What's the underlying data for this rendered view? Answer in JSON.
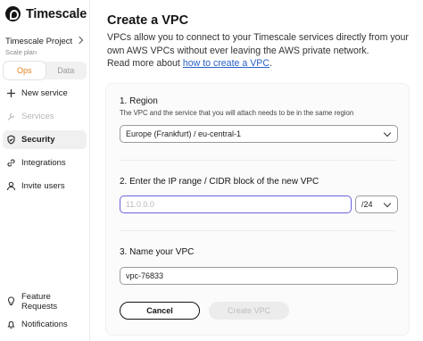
{
  "brand": {
    "name": "Timescale",
    "icon": "timescale-logo-icon"
  },
  "project": {
    "name": "Timescale Project",
    "plan": "Scale plan"
  },
  "segment": {
    "ops": "Ops",
    "data": "Data",
    "active_color": "#e0801a"
  },
  "nav": {
    "new_service": "New service",
    "services": "Services",
    "security": "Security",
    "integrations": "Integrations",
    "invite_users": "Invite users",
    "feature_requests": "Feature Requests",
    "notifications": "Notifications"
  },
  "page": {
    "title": "Create a VPC",
    "description": "VPCs allow you to connect to your Timescale services directly from your own AWS VPCs without ever leaving the AWS private network.",
    "read_more_prefix": "Read more about ",
    "read_more_link": "how to create a VPC",
    "read_more_suffix": "."
  },
  "form": {
    "region": {
      "title": "1. Region",
      "subtitle": "The VPC and the service that you will attach needs to be in the same region",
      "value": "Europe (Frankfurt) / eu-central-1"
    },
    "cidr": {
      "title": "2. Enter the IP range / CIDR block of the new VPC",
      "placeholder": "11.0.0.0",
      "suffix": "/24"
    },
    "name": {
      "title": "3. Name your VPC",
      "value": "vpc-76833"
    },
    "cancel": "Cancel",
    "create": "Create VPC"
  },
  "colors": {
    "link": "#2860c8",
    "focus": "#6a63d9"
  }
}
